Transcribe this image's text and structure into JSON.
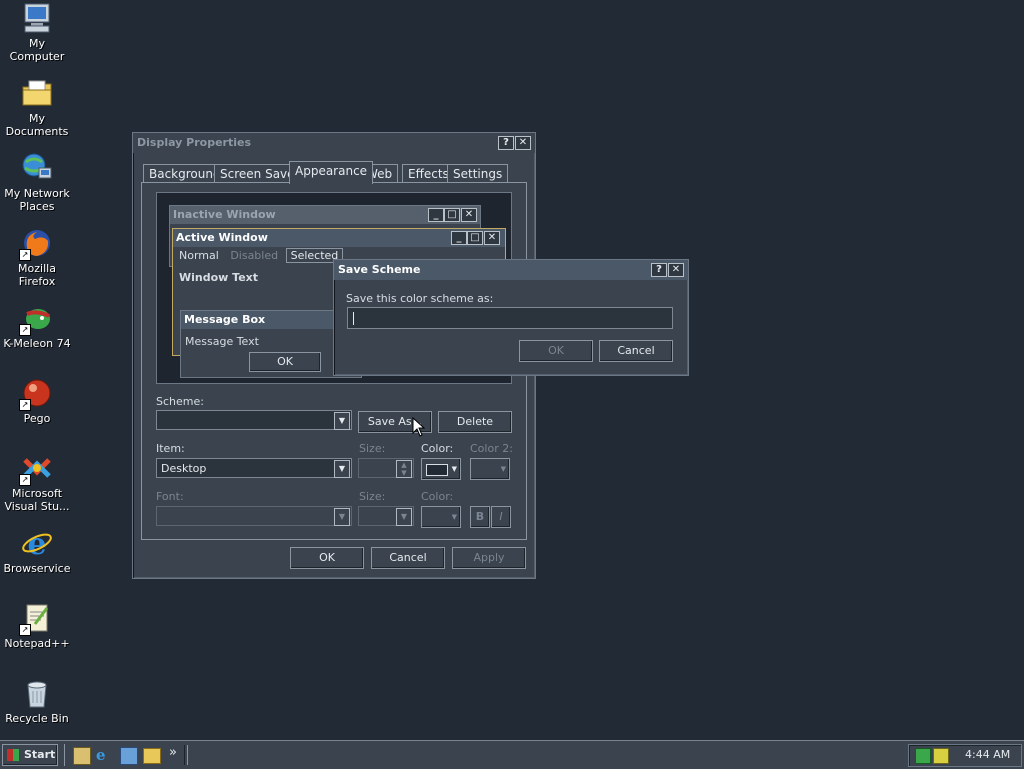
{
  "desktop": {
    "icons": [
      {
        "label": "My Computer"
      },
      {
        "label": "My Documents"
      },
      {
        "label": "My Network Places"
      },
      {
        "label": "Mozilla Firefox"
      },
      {
        "label": "K-Meleon 74"
      },
      {
        "label": "Pego"
      },
      {
        "label": "Microsoft Visual Stu..."
      },
      {
        "label": "Browservice"
      },
      {
        "label": "Notepad++"
      },
      {
        "label": "Recycle Bin"
      }
    ]
  },
  "display_properties": {
    "title": "Display Properties",
    "tabs": [
      "Background",
      "Screen Saver",
      "Appearance",
      "Web",
      "Effects",
      "Settings"
    ],
    "active_tab": "Appearance",
    "preview": {
      "inactive_title": "Inactive Window",
      "active_title": "Active Window",
      "menu_normal": "Normal",
      "menu_disabled": "Disabled",
      "menu_selected": "Selected",
      "window_text": "Window Text",
      "msgbox_title": "Message Box",
      "msgbox_text": "Message Text",
      "msgbox_ok": "OK"
    },
    "scheme_label": "Scheme:",
    "scheme_value": "",
    "save_as_label": "Save As...",
    "delete_label": "Delete",
    "item_label": "Item:",
    "item_value": "Desktop",
    "size_label": "Size:",
    "color_label": "Color:",
    "color2_label": "Color 2:",
    "font_label": "Font:",
    "font_size_label": "Size:",
    "font_color_label": "Color:",
    "bold_label": "B",
    "italic_label": "I",
    "ok_label": "OK",
    "cancel_label": "Cancel",
    "apply_label": "Apply"
  },
  "save_scheme": {
    "title": "Save Scheme",
    "prompt": "Save this color scheme as:",
    "input_value": "",
    "ok_label": "OK",
    "cancel_label": "Cancel"
  },
  "taskbar": {
    "start_label": "Start",
    "chevron": "»",
    "clock": "4:44 AM"
  },
  "colors": {
    "desktop_bg": "#222a35",
    "active_title": "#4a5868",
    "inactive_title": "#55606c"
  }
}
